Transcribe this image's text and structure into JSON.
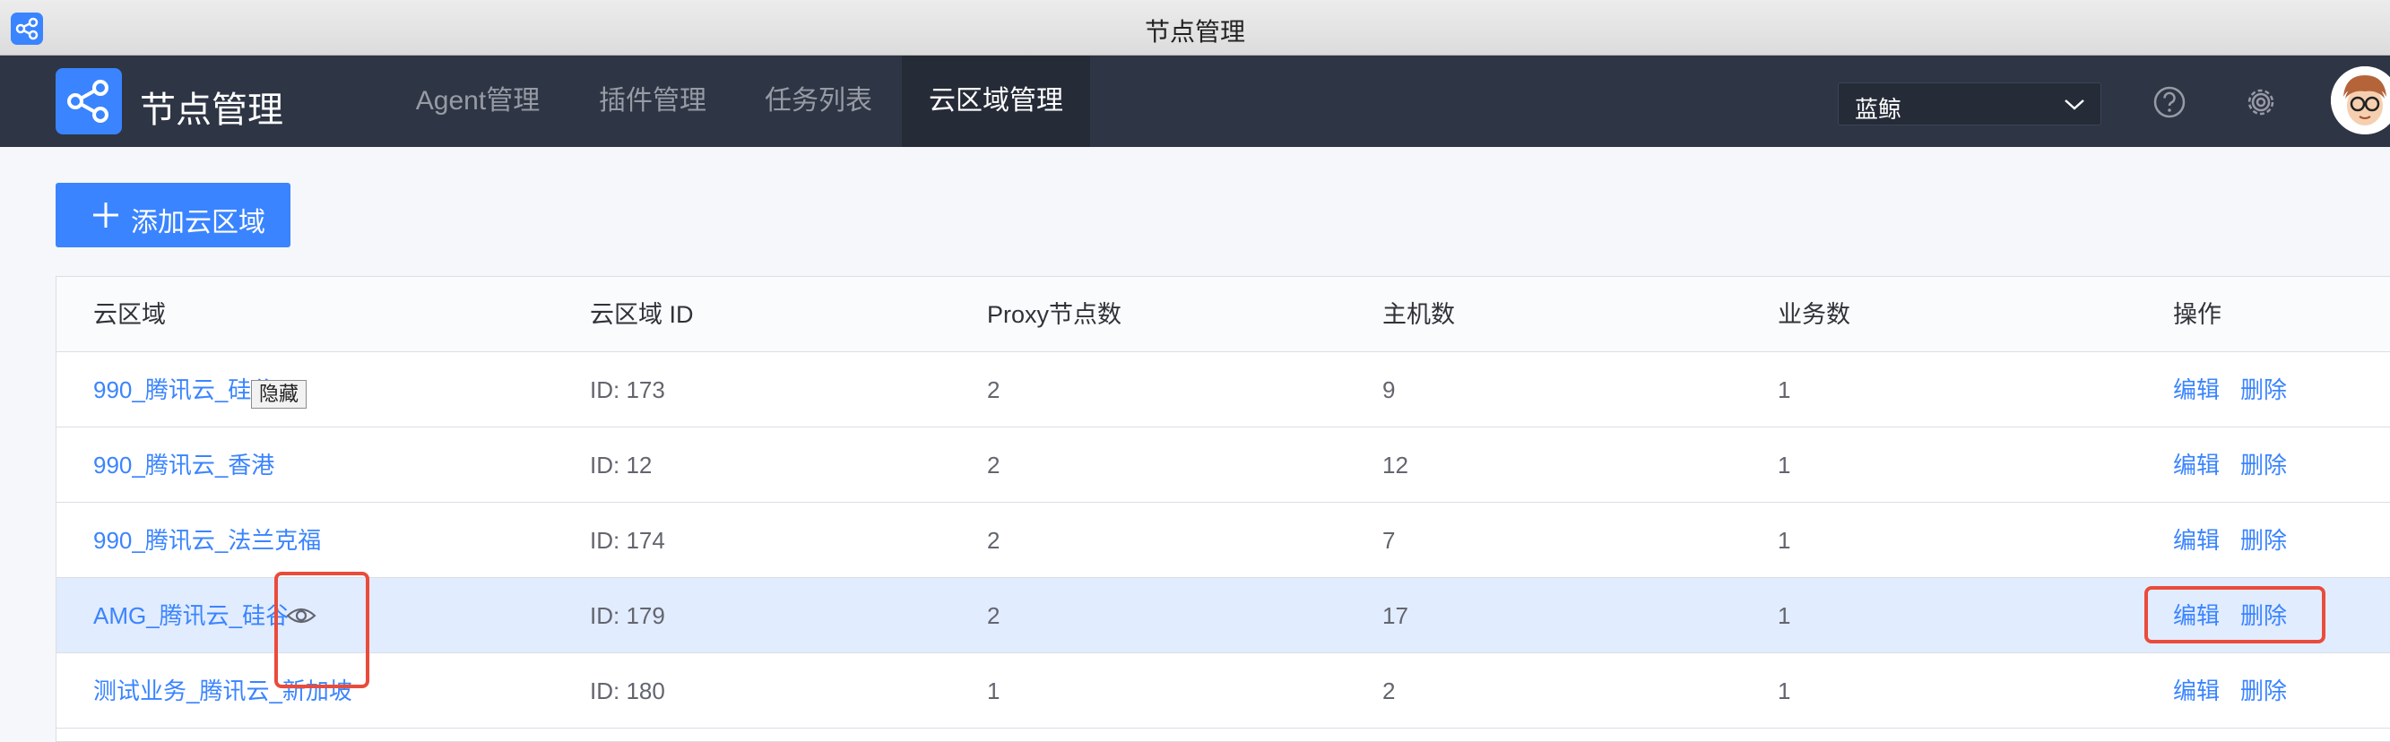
{
  "window": {
    "title": "节点管理"
  },
  "nav": {
    "brand": "节点管理",
    "tabs": [
      {
        "label": "Agent管理"
      },
      {
        "label": "插件管理"
      },
      {
        "label": "任务列表"
      },
      {
        "label": "云区域管理",
        "active": true
      }
    ],
    "business_select": {
      "value": "蓝鲸"
    },
    "help_icon": "help-icon",
    "settings_icon": "gear-icon"
  },
  "toolbar": {
    "add_label": "添加云区域"
  },
  "table": {
    "columns": [
      "云区域",
      "云区域 ID",
      "Proxy节点数",
      "主机数",
      "业务数",
      "操作"
    ],
    "rows": [
      {
        "name": "990_腾讯云_硅谷",
        "id": "ID: 173",
        "proxy": "2",
        "hosts": "9",
        "biz": "1"
      },
      {
        "name": "990_腾讯云_香港",
        "id": "ID: 12",
        "proxy": "2",
        "hosts": "12",
        "biz": "1"
      },
      {
        "name": "990_腾讯云_法兰克福",
        "id": "ID: 174",
        "proxy": "2",
        "hosts": "7",
        "biz": "1"
      },
      {
        "name": "AMG_腾讯云_硅谷",
        "id": "ID: 179",
        "proxy": "2",
        "hosts": "17",
        "biz": "1"
      },
      {
        "name": "测试业务_腾讯云_新加坡",
        "id": "ID: 180",
        "proxy": "1",
        "hosts": "2",
        "biz": "1"
      }
    ],
    "edit_label": "编辑",
    "delete_label": "删除",
    "tooltip": "隐藏"
  },
  "colors": {
    "accent": "#3a84ff",
    "nav_bg": "#2e3544",
    "annotation": "#ea4b3b"
  }
}
